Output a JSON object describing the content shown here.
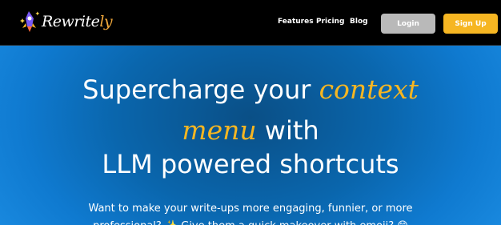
{
  "brand": {
    "name_main": "Rewrite",
    "name_accent": "ly"
  },
  "nav": {
    "links": [
      "Features",
      "Pricing",
      "Blog"
    ],
    "login_label": "Login",
    "signup_label": "Sign Up"
  },
  "hero": {
    "line1_plain": "Supercharge your ",
    "line1_highlight": "context",
    "line2_highlight": "menu",
    "line2_plain": " with",
    "line3": "LLM powered shortcuts",
    "subtext_line1": "Want to make your write-ups more engaging, funnier, or more",
    "subtext_line2": "professional? ✨ Give them a quick makeover with emoji? 😊"
  },
  "colors": {
    "accent": "#f6b622",
    "login_bg": "#b9b9b9",
    "hero_blue": "#0a66ad"
  }
}
